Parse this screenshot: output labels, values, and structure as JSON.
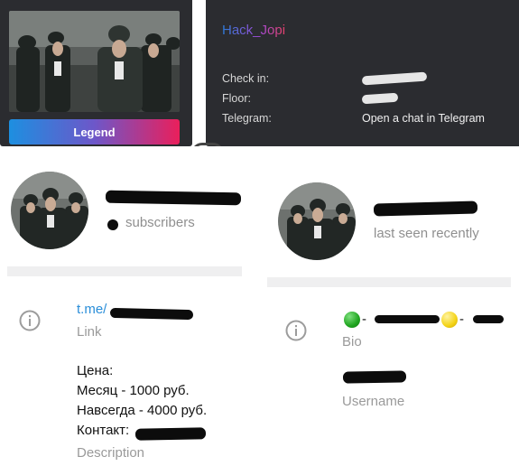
{
  "profile": {
    "username": "Hack_Jopi",
    "legend_label": "Legend",
    "rows": [
      {
        "label": "Check in:",
        "value": ""
      },
      {
        "label": "Floor:",
        "value": ""
      },
      {
        "label": "Telegram:",
        "value": "Open a chat in Telegram"
      }
    ]
  },
  "channel": {
    "subscribers_text": "subscribers",
    "link_text": "t.me/",
    "link_caption": "Link",
    "description_lines": [
      "Цена:",
      "Месяц - 1000 руб.",
      "Навсегда - 4000 руб.",
      "Контакт: "
    ],
    "description_caption": "Description"
  },
  "user": {
    "status_text": "last seen recently",
    "bio_caption": "Bio",
    "bio_separator": " - ",
    "username_caption": "Username",
    "colors": {
      "green_dot": "#1fa51f",
      "yellow_dot": "#f4d316"
    }
  },
  "colors": {
    "dark_card": "#2b2c30",
    "link": "#2a8ed9",
    "muted": "#9a9a9a",
    "divider": "#efeff0"
  }
}
